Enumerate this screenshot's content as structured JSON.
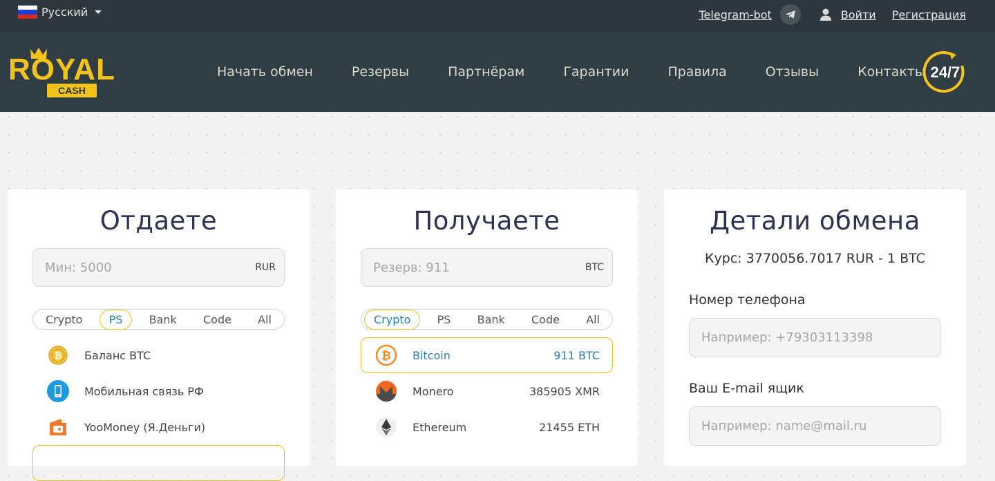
{
  "topbar": {
    "language": "Русский",
    "telegram_label": "Telegram-bot",
    "login_label": "Войти",
    "register_label": "Регистрация"
  },
  "nav": {
    "logo_text": "ROYAL",
    "logo_sub": "CASH",
    "items": [
      "Начать обмен",
      "Резервы",
      "Партнёрам",
      "Гарантии",
      "Правила",
      "Отзывы",
      "Контакты"
    ],
    "support_badge": "24/7"
  },
  "give": {
    "title": "Отдаете",
    "amount_placeholder": "Мин: 5000",
    "currency": "RUR",
    "tabs": [
      "Crypto",
      "PS",
      "Bank",
      "Code",
      "All"
    ],
    "active_tab": "PS",
    "items": [
      {
        "name": "Баланс BTC",
        "icon": "btc-balance-icon"
      },
      {
        "name": "Мобильная связь РФ",
        "icon": "mobile-phone-icon"
      },
      {
        "name": "YooMoney (Я.Деньги)",
        "icon": "yoomoney-icon"
      }
    ]
  },
  "receive": {
    "title": "Получаете",
    "amount_placeholder": "Резерв: 911",
    "currency": "BTC",
    "tabs": [
      "Crypto",
      "PS",
      "Bank",
      "Code",
      "All"
    ],
    "active_tab": "Crypto",
    "items": [
      {
        "name": "Bitcoin",
        "amount": "911 BTC",
        "icon": "bitcoin-icon"
      },
      {
        "name": "Monero",
        "amount": "385905 XMR",
        "icon": "monero-icon"
      },
      {
        "name": "Ethereum",
        "amount": "21455 ETH",
        "icon": "ethereum-icon"
      }
    ]
  },
  "details": {
    "title": "Детали обмена",
    "rate": "Курс: 3770056.7017 RUR - 1 BTC",
    "phone_label": "Номер телефона",
    "phone_placeholder": "Например: +79303113398",
    "email_label": "Ваш E-mail ящик",
    "email_placeholder": "Например: name@mail.ru"
  },
  "colors": {
    "topbar": "#2e373d",
    "navbar": "#313d44",
    "accent_yellow": "#e6c220",
    "link_blue": "#2a7fb0"
  }
}
